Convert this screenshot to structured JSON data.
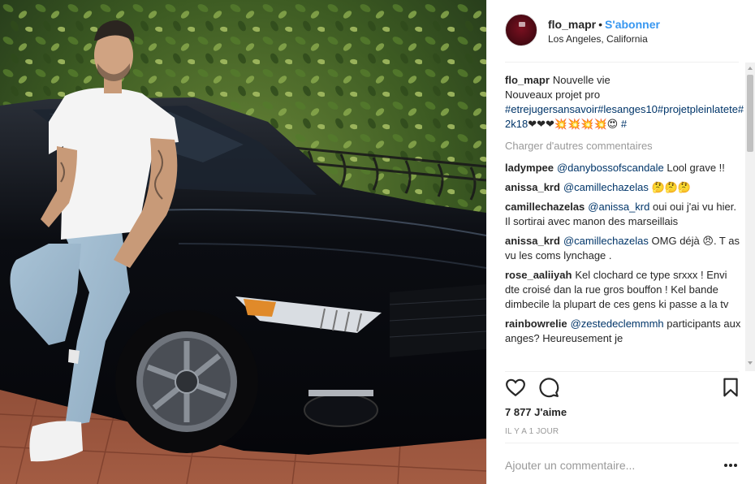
{
  "post": {
    "username": "flo_mapr",
    "separator": "•",
    "follow_label": "S'abonner",
    "location": "Los Angeles, California"
  },
  "caption": {
    "user": "flo_mapr",
    "line1": "Nouvelle vie",
    "line2": "Nouveaux projet pro",
    "hashtags": "#etrejugersansavoir#lesanges10#projetpleinlatete#2k18",
    "emojis": "❤❤❤💥💥💥💥😍",
    "hash_end": "#"
  },
  "load_more_label": "Charger d'autres commentaires",
  "comments": [
    {
      "user": "ladympee",
      "mention": "@danybossofscandale",
      "text": "Lool grave !!"
    },
    {
      "user": "anissa_krd",
      "mention": "@camillechazelas",
      "text": "🤔🤔🤔"
    },
    {
      "user": "camillechazelas",
      "mention": "@anissa_krd",
      "text": "oui oui j'ai vu hier. Il sortirai avec manon des marseillais"
    },
    {
      "user": "anissa_krd",
      "mention": "@camillechazelas",
      "text": "OMG déjà 😠. T as vu les coms lynchage ."
    },
    {
      "user": "rose_aaliiyah",
      "mention": "",
      "text": "Kel clochard ce type srxxx ! Envi dte croisé dan la rue gros bouffon ! Kel bande dimbecile la plupart de ces gens ki passe a la tv"
    },
    {
      "user": "rainbowrelie",
      "mention": "@zestedeclemmmh",
      "text": "participants aux anges? Heureusement je"
    }
  ],
  "actions": {
    "like_icon": "heart-icon",
    "comment_icon": "comment-icon",
    "save_icon": "bookmark-icon"
  },
  "likes": "7 877 J'aime",
  "time": "IL Y A 1 JOUR",
  "add_comment_placeholder": "Ajouter un commentaire...",
  "more_icon": "more-options-icon",
  "colors": {
    "link": "#3897f0",
    "tag": "#003569",
    "muted": "#999999"
  }
}
